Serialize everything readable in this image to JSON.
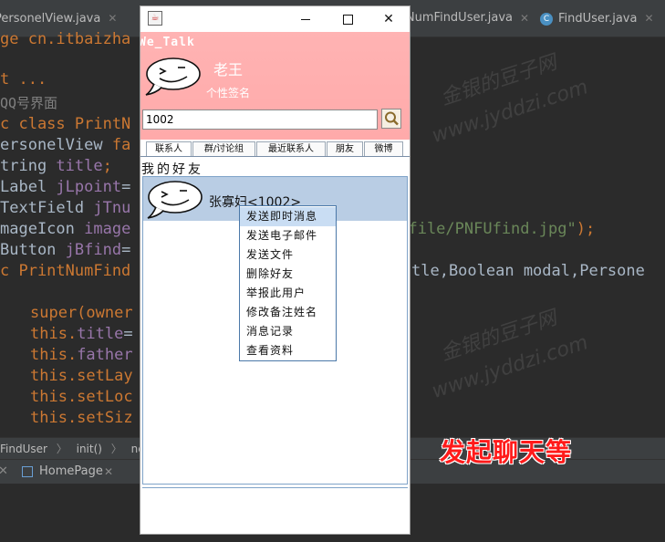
{
  "ide": {
    "tabs": [
      {
        "label": "PersonelView.java"
      },
      {
        "label": "PrintNumFindUser.java"
      },
      {
        "label": "FindUser.java"
      }
    ],
    "code_lines": {
      "l1a": "ge cn.itbaizha",
      "l2a": "t ...",
      "l3a": "QQ号界面",
      "l4a": "c class PrintN",
      "l5a": "ersonelView ",
      "l5b": "fa",
      "l6a": "tring ",
      "l6b": "title",
      "l6c": ";",
      "l7a": "Label ",
      "l7b": "jLpoint",
      "l7c": "=",
      "l8a": "TextField ",
      "l8b": "jTnu",
      "l9a": "mageIcon ",
      "l9b": "image",
      "l9c": "t/file/PNFUfind.jpg\"",
      "l9d": ");",
      "l10a": "Button ",
      "l10b": "jBfind",
      "l10c": "=",
      "l11a": "c PrintNumFind",
      "l11b": "tle,Boolean modal,Persone",
      "l12a": "super(owner",
      "l13a": "this.",
      "l13b": "title",
      "l13c": "=",
      "l14a": "this.",
      "l14b": "father",
      "l15a": "this.setLay",
      "l16a": "this.setLoc",
      "l17a": "this.setSiz"
    },
    "breadcrumb": [
      "FindUser",
      "init()",
      "new ..."
    ],
    "bottom_tab": "HomePage",
    "annotation": "发起聊天等"
  },
  "window": {
    "brand": "We_Talk",
    "username": "老王",
    "signature": "个性签名",
    "search_value": "1002",
    "contact_tabs": [
      "联系人",
      "群/讨论组",
      "最近联系人",
      "朋友",
      "微博"
    ],
    "group_label": "我的好友",
    "friend_label": "张寡妇<1002>",
    "context_menu": [
      "发送即时消息",
      "发送电子邮件",
      "发送文件",
      "删除好友",
      "举报此用户",
      "修改备注姓名",
      "消息记录",
      "查看资料"
    ]
  },
  "icons": {
    "window_icon": "java-coffee-icon",
    "minimize": "minimize-icon",
    "maximize": "maximize-icon",
    "close": "close-icon",
    "search": "search-icon",
    "avatar": "smiley-speech-bubble-icon"
  },
  "colors": {
    "header_bg": "#ffaaaa",
    "selected_row": "#b9cde4",
    "menu_hover": "#c9ddf3",
    "annotation": "#ff1a1a",
    "ide_bg": "#2b2b2b"
  }
}
